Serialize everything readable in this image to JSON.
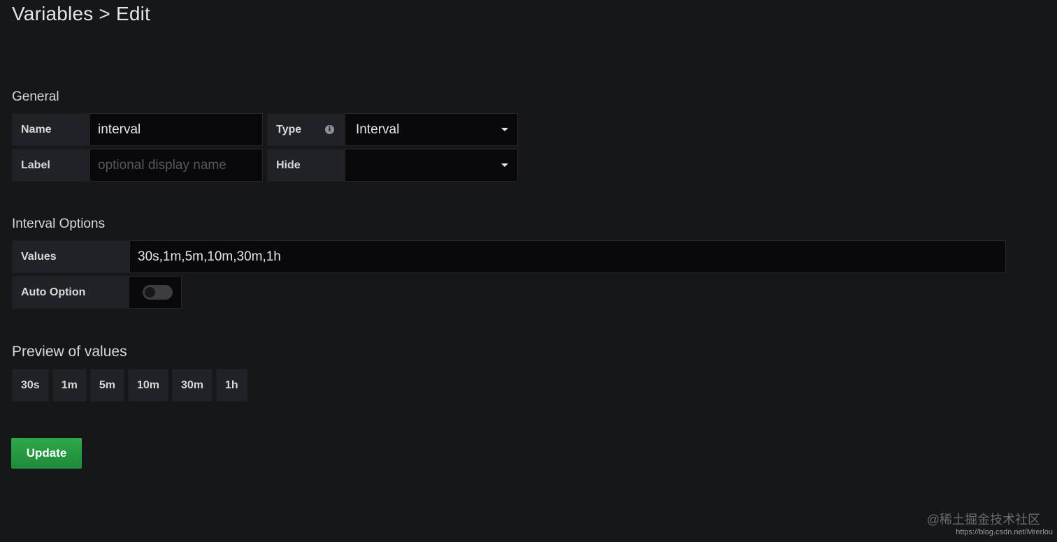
{
  "page": {
    "title": "Variables > Edit"
  },
  "general": {
    "heading": "General",
    "name_label": "Name",
    "name_value": "interval",
    "label_label": "Label",
    "label_placeholder": "optional display name",
    "type_label": "Type",
    "type_value": "Interval",
    "hide_label": "Hide",
    "hide_value": ""
  },
  "interval_options": {
    "heading": "Interval Options",
    "values_label": "Values",
    "values_value": "30s,1m,5m,10m,30m,1h",
    "auto_option_label": "Auto Option",
    "auto_option_enabled": false
  },
  "preview": {
    "heading": "Preview of values",
    "values": [
      "30s",
      "1m",
      "5m",
      "10m",
      "30m",
      "1h"
    ]
  },
  "actions": {
    "update_label": "Update"
  },
  "footer": {
    "watermark": "@稀土掘金技术社区",
    "url": "https://blog.csdn.net/Mrerlou"
  },
  "colors": {
    "background": "#161719",
    "update_button": "#299c46"
  },
  "icons": {
    "type_info": "info-icon",
    "select_caret": "caret-down-icon"
  }
}
